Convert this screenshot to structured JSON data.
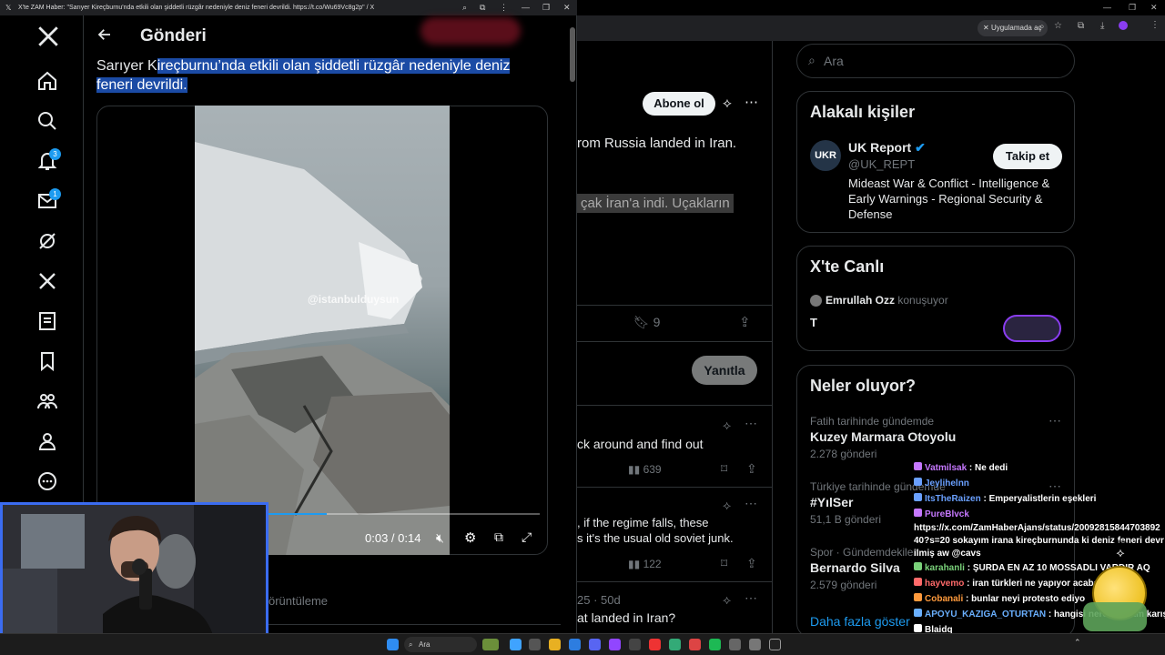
{
  "popup": {
    "title": "X'te ZAM Haber: \"Sarıyer Kireçburnu'nda etkili olan şiddetli rüzgâr nedeniyle deniz feneri devrildi. https://t.co/Wu69Vc8g2p\" / X",
    "header_title": "Gönderi",
    "post_text_unselected": "Sarıyer K",
    "post_text_selected": "ireçburnu’nda etkili olan şiddetli rüzgâr nedeniyle deniz feneri devrildi.",
    "video_watermark": "@istanbulduysun",
    "video_time": "0:03 / 0:14",
    "views_partial": "örüntüleme",
    "nav_badges": {
      "notifications": "3",
      "messages": "1"
    }
  },
  "browser": {
    "open_in_app": "Uygulamada aç"
  },
  "timeline": {
    "subscribe_label": "Abone ol",
    "tweet1_text": "rom Russia landed in Iran.",
    "tweet1_translation": "çak İran'a indi. Uçakların",
    "tweet1_bookmarks": "9",
    "reply_label": "Yanıtla",
    "tweet2_text": "ck around and find out",
    "tweet2_views": "639",
    "tweet3_text_1": ", if the regime falls, these",
    "tweet3_text_2": "s it's the usual old soviet junk.",
    "tweet3_views": "122",
    "tweet4_meta": "25 · 50d",
    "tweet4_text": "at landed in Iran?"
  },
  "sidebar": {
    "search_placeholder": "Ara",
    "related_title": "Alakalı kişiler",
    "person_avatar_text": "UKR",
    "person_name": "UK Report",
    "person_handle": "@UK_REPT",
    "person_bio": "Mideast War & Conflict - Intelligence & Early Warnings - Regional Security & Defense",
    "follow_label": "Takip et",
    "live_title": "X'te Canlı",
    "live_host": "Emrullah Ozz",
    "live_status": "konuşuyor",
    "live_text": "T",
    "trends_title": "Neler oluyor?",
    "trends": [
      {
        "context": "Fatih tarihinde gündemde",
        "name": "Kuzey Marmara Otoyolu",
        "count": "2.278 gönderi"
      },
      {
        "context": "Türkiye tarihinde gündemde",
        "name": "#YılSer",
        "count": "51,1 B gönderi"
      },
      {
        "context": "Spor · Gündemdekiler",
        "name": "Bernardo Silva",
        "count": "2.579 gönderi"
      }
    ],
    "show_more": "Daha fazla göster"
  },
  "chat": [
    {
      "user": "Vatmilsak",
      "color": "#c678ff",
      "msg": "Ne dedi"
    },
    {
      "user": "Jeylihelnn",
      "color": "#6aa0ff",
      "msg": ""
    },
    {
      "user": "ItsTheRaizen",
      "color": "#6aa0ff",
      "msg": "Emperyalistlerin eşekleri"
    },
    {
      "user": "PureBlvck",
      "color": "#c678ff",
      "msg": ""
    },
    {
      "user": "",
      "color": "#fff",
      "msg": "https://x.com/ZamHaberAjans/status/2009281584470389240?s=20 sokayım irana kireçburnunda ki deniz feneri devrilmiş aw @cavs"
    },
    {
      "user": "karahanli",
      "color": "#7ad17a",
      "msg": "ŞURDA EN AZ 10 MOSSADLI VARDIR AQ"
    },
    {
      "user": "hayvemo",
      "color": "#ff6a6a",
      "msg": "iran türkleri ne yapıyor acaba"
    },
    {
      "user": "Cobanali",
      "color": "#ff9a3c",
      "msg": "bunlar neyi protesto ediyo"
    },
    {
      "user": "APOYU_KAZIGA_OTURTAN",
      "color": "#6ab0ff",
      "msg": "hangisi neresi kafam karıştı mk"
    },
    {
      "user": "Blaidq",
      "color": "#fff",
      "msg": ""
    }
  ],
  "taskbar": {
    "search_placeholder": "Ara"
  },
  "colors": {
    "accent": "#1d9bf0",
    "selection": "#1b4ba5",
    "webcam_border": "#3b6cf0"
  }
}
